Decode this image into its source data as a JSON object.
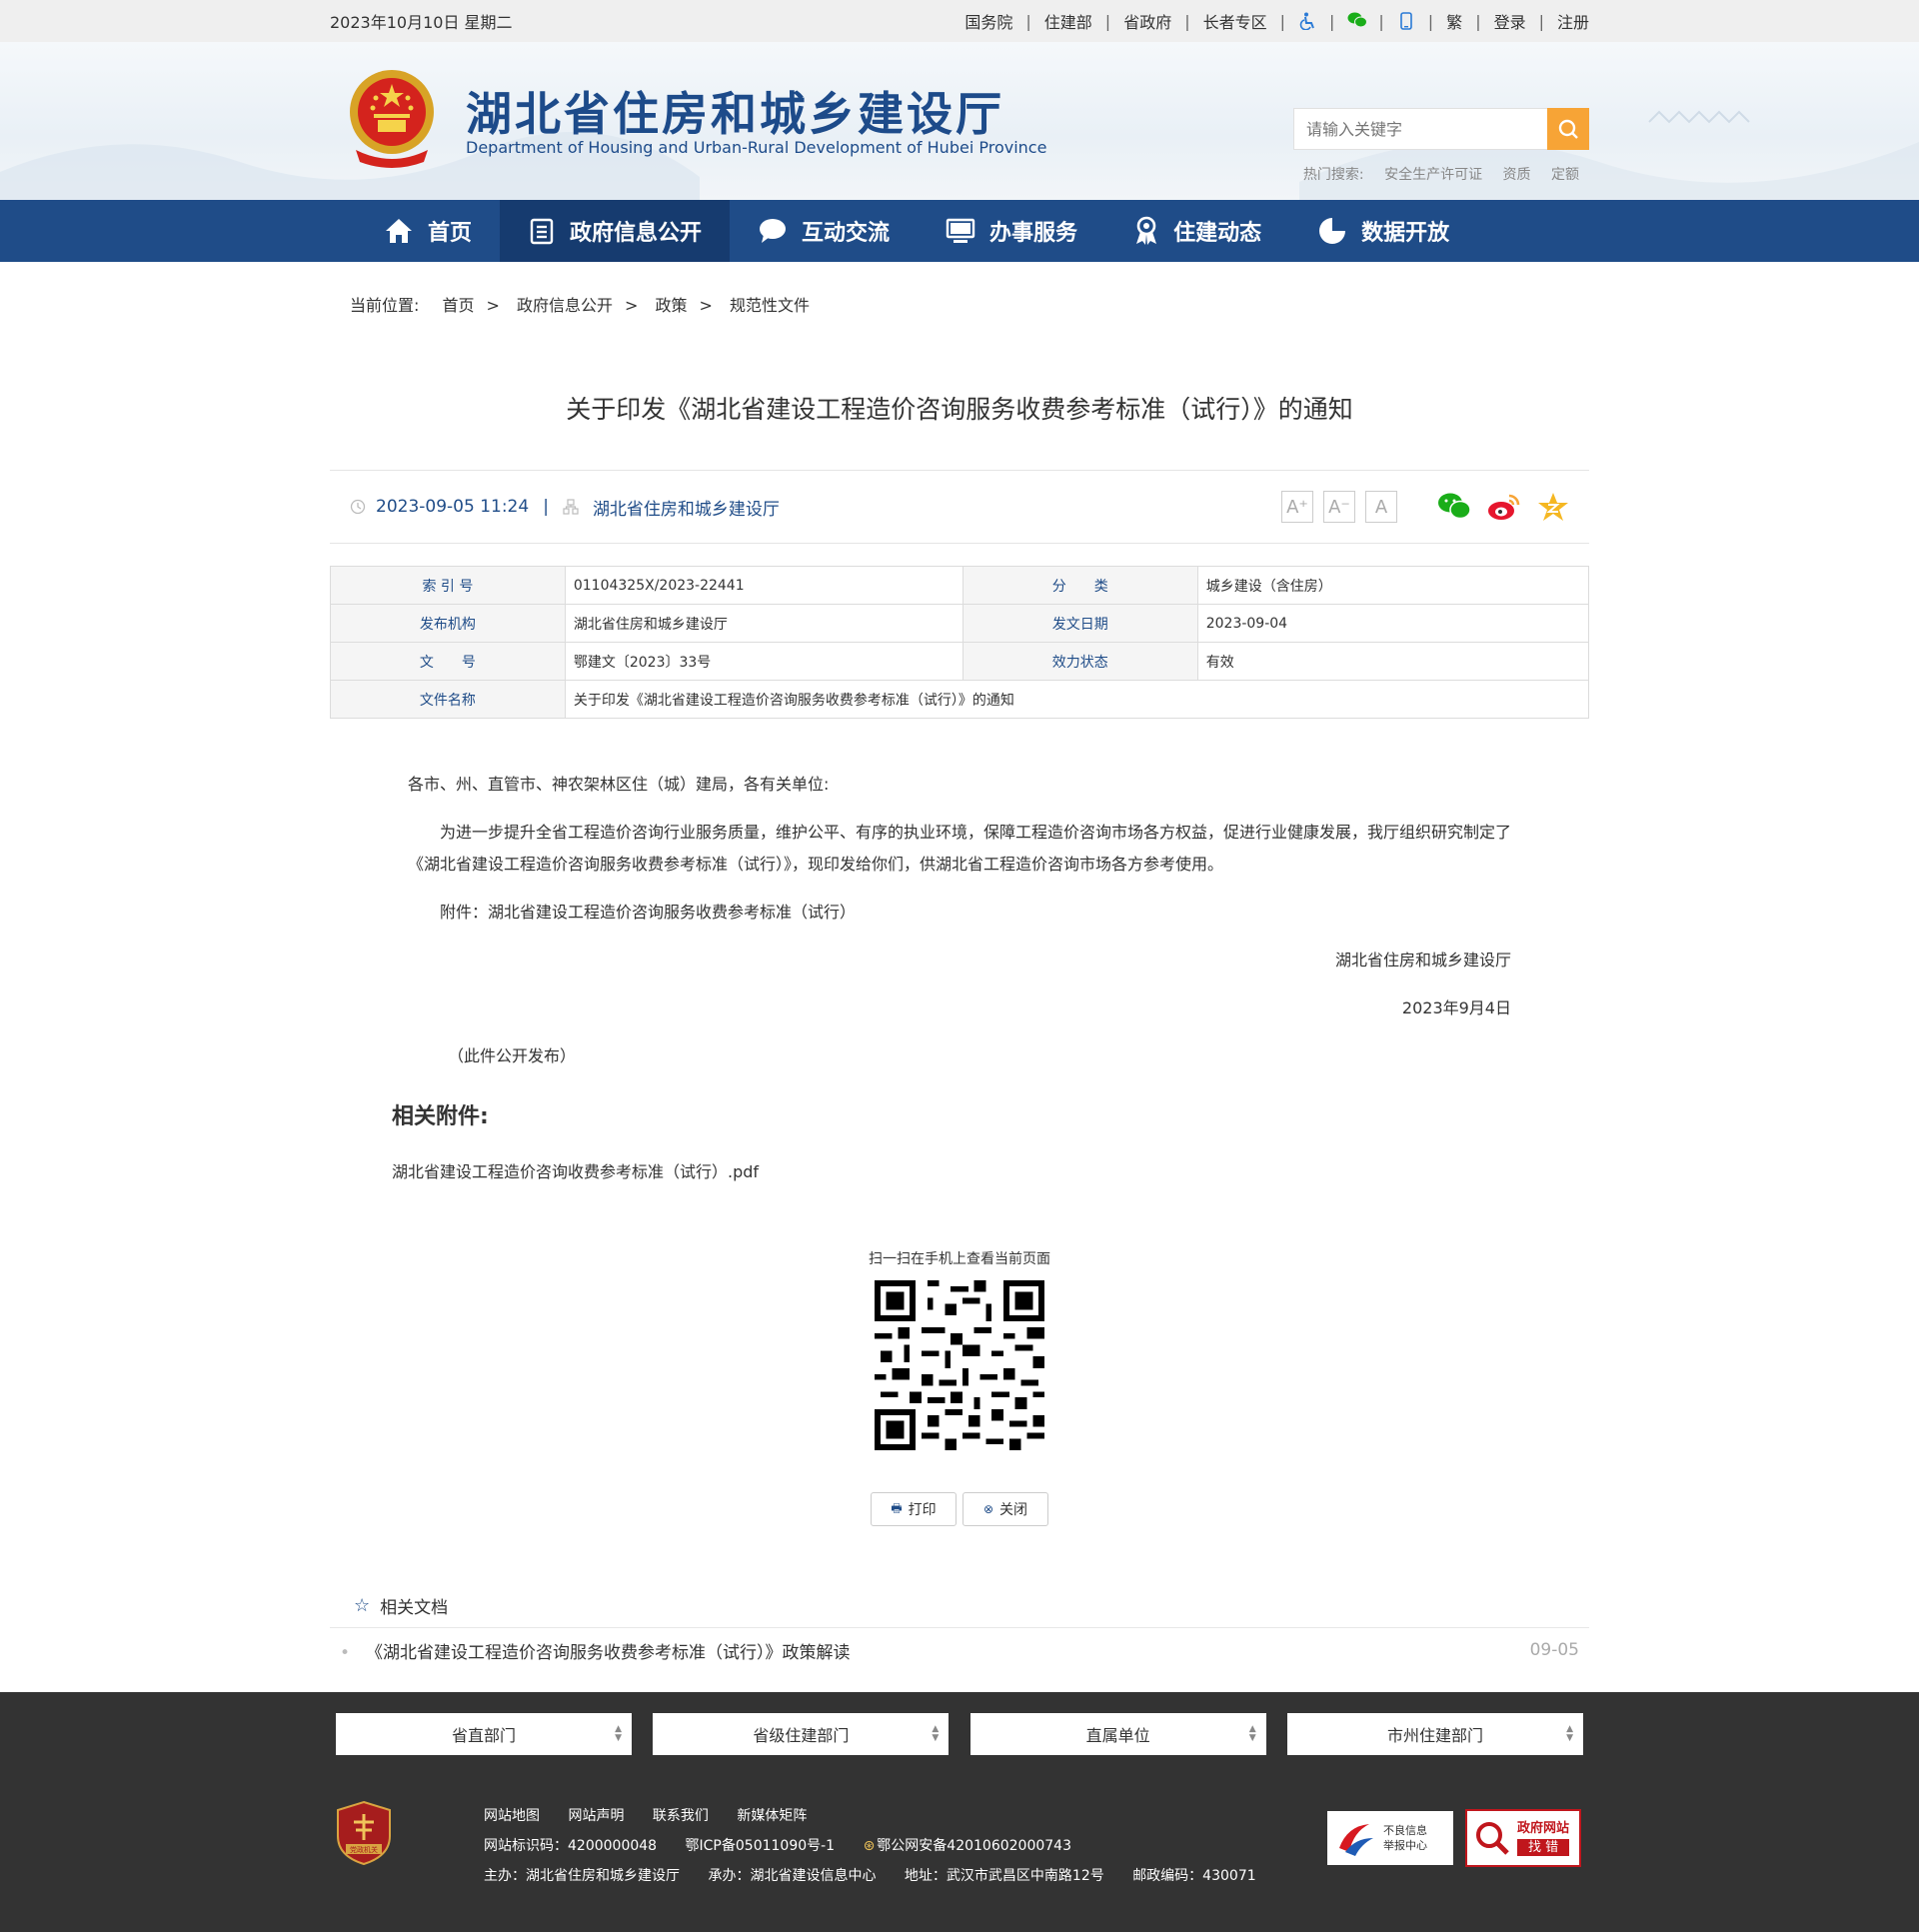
{
  "topbar": {
    "date": "2023年10月10日 星期二",
    "links": [
      "国务院",
      "住建部",
      "省政府",
      "长者专区"
    ],
    "icons": [
      "accessibility-icon",
      "wechat-icon",
      "mobile-icon"
    ],
    "trad": "繁",
    "login": "登录",
    "register": "注册"
  },
  "header": {
    "title": "湖北省住房和城乡建设厅",
    "subtitle": "Department of Housing and Urban-Rural Development of Hubei Province",
    "search_placeholder": "请输入关键字",
    "hot_label": "热门搜索:",
    "hot_terms": [
      "安全生产许可证",
      "资质",
      "定额"
    ]
  },
  "nav": [
    {
      "label": "首页",
      "icon": "home-icon"
    },
    {
      "label": "政府信息公开",
      "icon": "document-list-icon"
    },
    {
      "label": "互动交流",
      "icon": "chat-bubble-icon"
    },
    {
      "label": "办事服务",
      "icon": "monitor-icon"
    },
    {
      "label": "住建动态",
      "icon": "award-icon"
    },
    {
      "label": "数据开放",
      "icon": "pie-chart-icon"
    }
  ],
  "breadcrumb": {
    "label": "当前位置:",
    "items": [
      "首页",
      "政府信息公开",
      "政策",
      "规范性文件"
    ],
    "gt": ">"
  },
  "article": {
    "title": "关于印发《湖北省建设工程造价咨询服务收费参考标准（试行）》的通知",
    "datetime": "2023-09-05 11:24",
    "bar": "|",
    "source": "湖北省住房和城乡建设厅",
    "font_buttons": [
      "A⁺",
      "A⁻",
      "A"
    ]
  },
  "meta": {
    "index_k": "索 引 号",
    "index_v": "01104325X/2023-22441",
    "cat_k": "分　　类",
    "cat_v": "城乡建设（含住房）",
    "org_k": "发布机构",
    "org_v": "湖北省住房和城乡建设厅",
    "date_k": "发文日期",
    "date_v": "2023-09-04",
    "no_k": "文　　号",
    "no_v": "鄂建文〔2023〕33号",
    "status_k": "效力状态",
    "status_v": "有效",
    "name_k": "文件名称",
    "name_v": "关于印发《湖北省建设工程造价咨询服务收费参考标准（试行）》的通知"
  },
  "body": {
    "salutation": "各市、州、直管市、神农架林区住（城）建局，各有关单位:",
    "para1": "为进一步提升全省工程造价咨询行业服务质量，维护公平、有序的执业环境，保障工程造价咨询市场各方权益，促进行业健康发展，我厅组织研究制定了《湖北省建设工程造价咨询服务收费参考标准（试行）》，现印发给你们，供湖北省工程造价咨询市场各方参考使用。",
    "attachment_line": "附件：湖北省建设工程造价咨询服务收费参考标准（试行）",
    "signer": "湖北省住房和城乡建设厅",
    "sign_date": "2023年9月4日",
    "public_note": "（此件公开发布）",
    "attach_heading": "相关附件:",
    "attach_file": "湖北省建设工程造价咨询收费参考标准（试行）.pdf"
  },
  "qr": {
    "caption": "扫一扫在手机上查看当前页面"
  },
  "actions": {
    "print": "打印",
    "close": "关闭"
  },
  "related": {
    "title": "相关文档",
    "items": [
      {
        "text": "《湖北省建设工程造价咨询服务收费参考标准（试行）》政策解读",
        "date": "09-05"
      }
    ]
  },
  "footer": {
    "selects": [
      "省直部门",
      "省级住建部门",
      "直属单位",
      "市州住建部门"
    ],
    "links": [
      "网站地图",
      "网站声明",
      "联系我们",
      "新媒体矩阵"
    ],
    "site_id": "网站标识码：4200000048",
    "icp": "鄂ICP备05011090号-1",
    "police": "鄂公网安备42010602000743",
    "sponsor": "主办：湖北省住房和城乡建设厅",
    "undertaker": "承办：湖北省建设信息中心",
    "address": "地址：武汉市武昌区中南路12号",
    "postcode": "邮政编码：430071",
    "party_badge": "党政机关",
    "badge1_line1": "不良信息",
    "badge1_line2": "举报中心",
    "badge2_line1": "政府网站",
    "badge2_line2": "找 错"
  },
  "colors": {
    "nav_bg": "#1f4c88",
    "nav_active": "#163b6f",
    "search_btn": "#f7a436",
    "footer_bg": "#333333"
  }
}
